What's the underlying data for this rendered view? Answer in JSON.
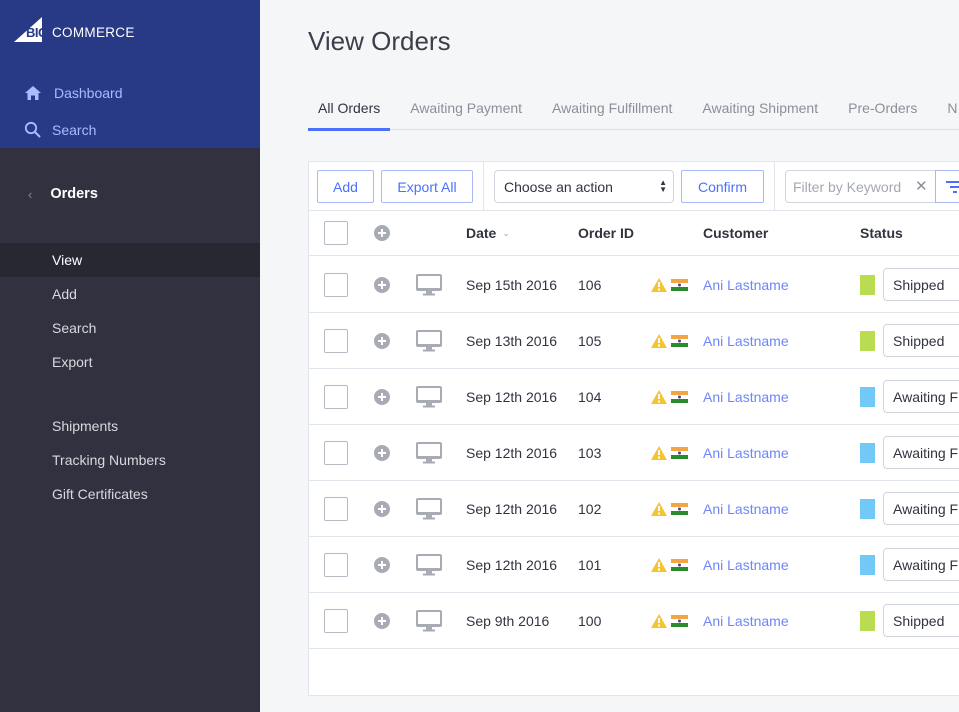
{
  "brand": {
    "logo_big": "BIG",
    "logo_rest": "COMMERCE",
    "accent": "#4b71fc",
    "sidebar_top_color": "#283a85",
    "sidebar_color": "#313140"
  },
  "sidebar": {
    "top_nav": [
      {
        "label": "Dashboard",
        "icon": "home-icon"
      },
      {
        "label": "Search",
        "icon": "search-icon"
      }
    ],
    "section": {
      "label": "Orders",
      "icon": "chevron-left-icon"
    },
    "items": [
      {
        "label": "View",
        "active": true
      },
      {
        "label": "Add"
      },
      {
        "label": "Search"
      },
      {
        "label": "Export"
      },
      {
        "label": "Shipments"
      },
      {
        "label": "Tracking Numbers"
      },
      {
        "label": "Gift Certificates"
      }
    ]
  },
  "page": {
    "title": "View Orders"
  },
  "tabs": [
    {
      "label": "All Orders",
      "active": true
    },
    {
      "label": "Awaiting Payment"
    },
    {
      "label": "Awaiting Fulfillment"
    },
    {
      "label": "Awaiting Shipment"
    },
    {
      "label": "Pre-Orders"
    },
    {
      "label": "N"
    }
  ],
  "toolbar": {
    "add_label": "Add",
    "export_label": "Export All",
    "action_select": "Choose an action",
    "confirm_label": "Confirm",
    "filter_placeholder": "Filter by Keyword",
    "filter_value": ""
  },
  "table": {
    "columns": {
      "date": "Date",
      "order_id": "Order ID",
      "customer": "Customer",
      "status": "Status"
    },
    "status_colors": {
      "Shipped": "#b9dc52",
      "Awaiting Fulfillment": "#72c9f8"
    },
    "rows": [
      {
        "date": "Sep 15th 2016",
        "order_id": "106",
        "customer": "Ani Lastname",
        "status": "Shipped"
      },
      {
        "date": "Sep 13th 2016",
        "order_id": "105",
        "customer": "Ani Lastname",
        "status": "Shipped"
      },
      {
        "date": "Sep 12th 2016",
        "order_id": "104",
        "customer": "Ani Lastname",
        "status": "Awaiting Fulfillment"
      },
      {
        "date": "Sep 12th 2016",
        "order_id": "103",
        "customer": "Ani Lastname",
        "status": "Awaiting Fulfillment"
      },
      {
        "date": "Sep 12th 2016",
        "order_id": "102",
        "customer": "Ani Lastname",
        "status": "Awaiting Fulfillment"
      },
      {
        "date": "Sep 12th 2016",
        "order_id": "101",
        "customer": "Ani Lastname",
        "status": "Awaiting Fulfillment"
      },
      {
        "date": "Sep 9th 2016",
        "order_id": "100",
        "customer": "Ani Lastname",
        "status": "Shipped"
      }
    ]
  }
}
